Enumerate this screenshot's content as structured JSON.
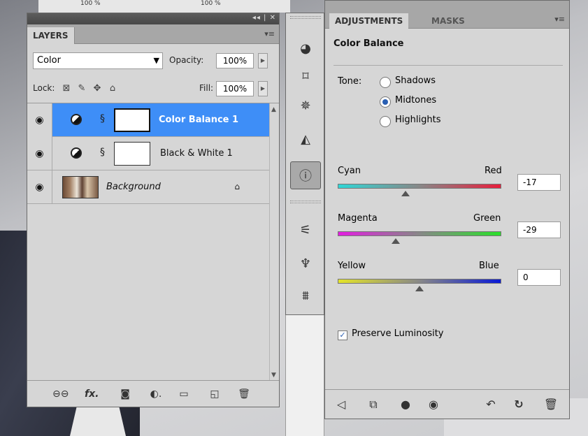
{
  "background": {
    "zoom_left": "100 %",
    "zoom_right": "100 %"
  },
  "layers_panel": {
    "tab": "LAYERS",
    "blend_mode": "Color",
    "opacity_label": "Opacity:",
    "opacity_value": "100%",
    "lock_label": "Lock:",
    "fill_label": "Fill:",
    "fill_value": "100%",
    "layers": [
      {
        "name": "Color Balance 1",
        "selected": true,
        "type": "adjustment"
      },
      {
        "name": "Black & White 1",
        "selected": false,
        "type": "adjustment"
      },
      {
        "name": "Background",
        "selected": false,
        "type": "image",
        "locked": true
      }
    ]
  },
  "adjustments_panel": {
    "tab_active": "ADJUSTMENTS",
    "tab_inactive": "MASKS",
    "title": "Color Balance",
    "tone_label": "Tone:",
    "tones": [
      "Shadows",
      "Midtones",
      "Highlights"
    ],
    "tone_selected": "Midtones",
    "sliders": [
      {
        "left": "Cyan",
        "right": "Red",
        "value": "-17",
        "position": -17,
        "left_color": "#2fd6d6",
        "right_color": "#e81e3c"
      },
      {
        "left": "Magenta",
        "right": "Green",
        "value": "-29",
        "position": -29,
        "left_color": "#e21ee0",
        "right_color": "#2ae02a"
      },
      {
        "left": "Yellow",
        "right": "Blue",
        "value": "0",
        "position": 0,
        "left_color": "#e4e42a",
        "right_color": "#0a1ad6"
      }
    ],
    "preserve_luminosity": "Preserve Luminosity",
    "preserve_checked": true
  },
  "colors": {
    "selection": "#3e8ef7",
    "panel": "#d6d6d6"
  }
}
